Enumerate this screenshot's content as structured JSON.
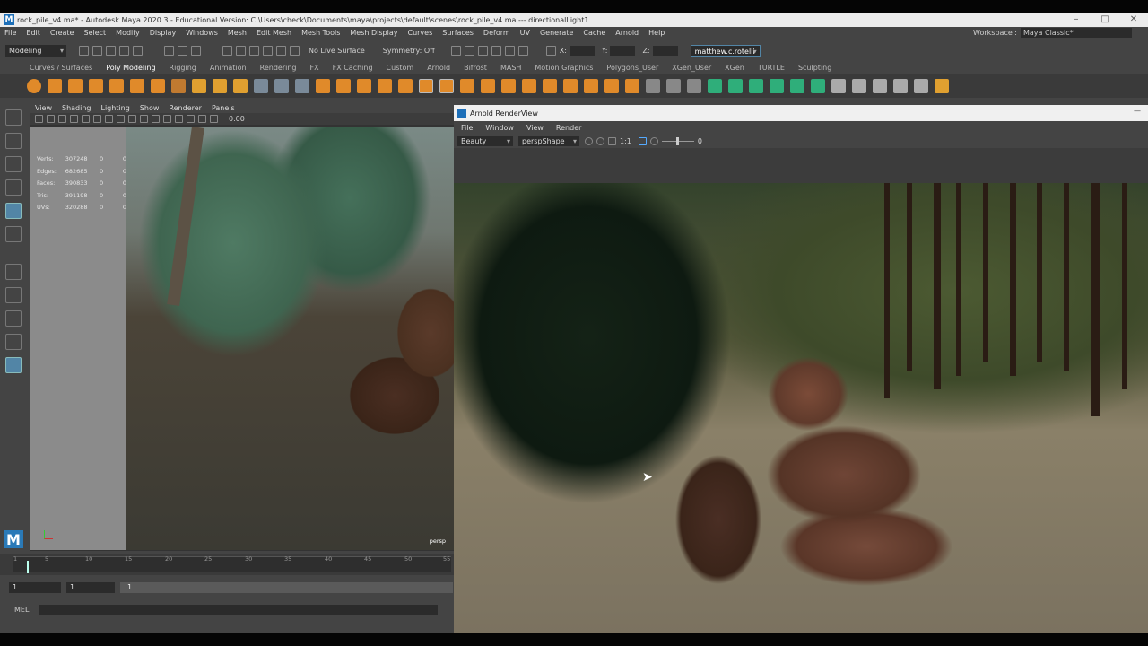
{
  "window": {
    "title": "rock_pile_v4.ma* - Autodesk Maya 2020.3 - Educational Version: C:\\Users\\check\\Documents\\maya\\projects\\default\\scenes\\rock_pile_v4.ma  ---  directionalLight1"
  },
  "menus": [
    "File",
    "Edit",
    "Create",
    "Select",
    "Modify",
    "Display",
    "Windows",
    "Mesh",
    "Edit Mesh",
    "Mesh Tools",
    "Mesh Display",
    "Curves",
    "Surfaces",
    "Deform",
    "UV",
    "Generate",
    "Cache",
    "Arnold",
    "Help"
  ],
  "workspace": {
    "label": "Workspace :",
    "value": "Maya Classic*"
  },
  "status": {
    "mode": "Modeling",
    "live_surface": "No Live Surface",
    "symmetry": "Symmetry: Off",
    "x_label": "X:",
    "y_label": "Y:",
    "z_label": "Z:",
    "user": "matthew.c.rotelli"
  },
  "shelf_tabs": [
    "Curves / Surfaces",
    "Poly Modeling",
    "Rigging",
    "Animation",
    "Rendering",
    "FX",
    "FX Caching",
    "Custom",
    "Arnold",
    "Bifrost",
    "MASH",
    "Motion Graphics",
    "Polygons_User",
    "XGen_User",
    "XGen",
    "TURTLE",
    "Sculpting"
  ],
  "active_shelf_tab": "Poly Modeling",
  "viewport": {
    "menus": [
      "View",
      "Shading",
      "Lighting",
      "Show",
      "Renderer",
      "Panels"
    ],
    "camera": "persp",
    "field_value": "0.00",
    "hud": [
      {
        "label": "Verts:",
        "value": "307248",
        "a": "0",
        "b": "0"
      },
      {
        "label": "Edges:",
        "value": "682685",
        "a": "0",
        "b": "0"
      },
      {
        "label": "Faces:",
        "value": "390833",
        "a": "0",
        "b": "0"
      },
      {
        "label": "Tris:",
        "value": "391198",
        "a": "0",
        "b": "0"
      },
      {
        "label": "UVs:",
        "value": "320288",
        "a": "0",
        "b": "0"
      }
    ]
  },
  "timeline": {
    "ticks": [
      "1",
      "5",
      "10",
      "15",
      "20",
      "25",
      "30",
      "35",
      "40",
      "45",
      "50",
      "55"
    ],
    "range_start": "1",
    "range_start2": "1",
    "slider_value": "1"
  },
  "command_line": {
    "label": "MEL"
  },
  "render_view": {
    "title": "Arnold RenderView",
    "menus": [
      "File",
      "Window",
      "View",
      "Render"
    ],
    "aov": "Beauty",
    "camera": "perspShape",
    "ratio": "1:1",
    "exposure": "0"
  },
  "colors": {
    "accent": "#5285a6",
    "maya_blue": "#1d6fb8",
    "ui_bg": "#444444"
  }
}
